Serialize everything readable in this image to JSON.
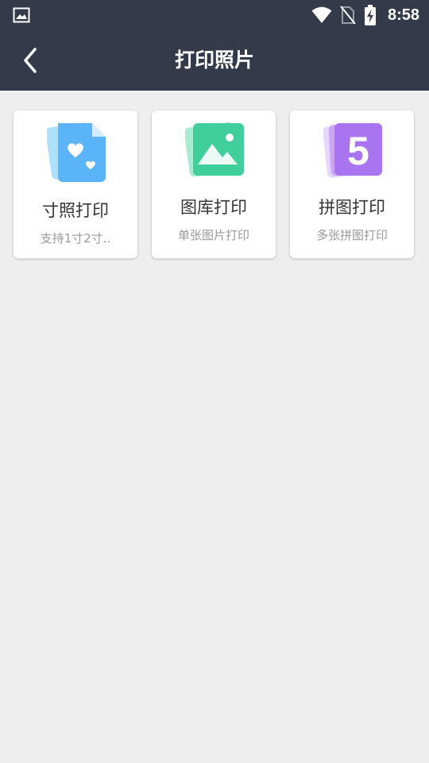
{
  "status_bar": {
    "time": "8:58",
    "icons": [
      "image-notification-icon",
      "wifi-icon",
      "no-sim-icon",
      "battery-charging-icon"
    ]
  },
  "header": {
    "title": "打印照片",
    "back_icon": "chevron-left-icon"
  },
  "cards": [
    {
      "label": "寸照打印",
      "subtitle": "支持1寸2寸..",
      "icon": "id-photo-icon",
      "color": "#5ab4f7"
    },
    {
      "label": "图库打印",
      "subtitle": "单张图片打印",
      "icon": "gallery-icon",
      "color": "#3fce9c"
    },
    {
      "label": "拼图打印",
      "subtitle": "多张拼图打印",
      "icon": "collage-icon",
      "color": "#a974f0"
    }
  ],
  "collage_icon_glyph": "5",
  "colors": {
    "header_bg": "#343a4a",
    "page_bg": "#eeeeee"
  }
}
